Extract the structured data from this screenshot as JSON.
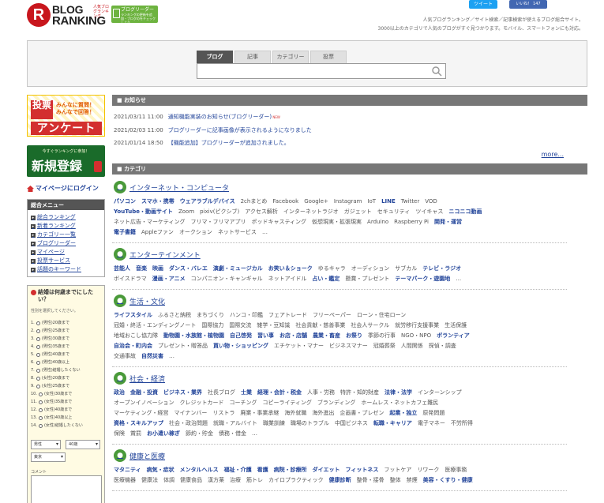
{
  "header": {
    "logo_text_1": "BLOG",
    "logo_text_2": "RANKING",
    "logo_sub": "人気ブログランキング",
    "reader_badge_title": "ブログリーダー",
    "reader_badge_sub": "ランキングの更新を追加・ブログのをチェックしよう",
    "tweet_label": "ツイート",
    "like_label": "いいね！ 147",
    "tagline_1": "人気ブログランキング／サイト検索／記事検索が使えるブログ総合サイト。",
    "tagline_2": "3000以上のカテゴリで人気のブログがすぐ見つかります。モバイル、スマートフォンにも対応。"
  },
  "search": {
    "tabs": [
      "ブログ",
      "記事",
      "カテゴリー",
      "投票"
    ],
    "active_tab": 0,
    "value": ""
  },
  "sidebar": {
    "vote_banner_icon": "投票",
    "vote_banner_text_1": "みんなに質問！",
    "vote_banner_text_2": "みんなで回答！",
    "vote_banner_title": "アンケート",
    "register_sub": "今すぐランキングに参加！",
    "register_title": "新規登録",
    "mypage_login": "マイページにログイン",
    "menu_title": "総合メニュー",
    "menu_items": [
      "総合ランキング",
      "新着ランキング",
      "カテゴリー一覧",
      "ブログリーダー",
      "マイページ",
      "投票サービス",
      "話題のキーワード"
    ],
    "survey_question": "結婚は何歳までにしたい？",
    "survey_note": "性別を選択してください。",
    "survey_options": [
      "1. (男性)20歳まで",
      "2. (男性)25歳まで",
      "3. (男性)30歳まで",
      "4. (男性)35歳まで",
      "5. (男性)40歳まで",
      "6. (男性)40歳以上",
      "7. (男性)結婚したくない",
      "8. (女性)20歳まで",
      "9. (女性)25歳まで",
      "10. (女性)30歳まで",
      "11. (女性)35歳まで",
      "12. (女性)40歳まで",
      "13. (女性)40歳以上",
      "14. (女性)結婚したくない"
    ],
    "survey_select_1": "男性",
    "survey_select_2": "40歳",
    "survey_select_3": "東京",
    "survey_comment_label": "コメント"
  },
  "news": {
    "title": "お知らせ",
    "items": [
      {
        "date": "2021/03/11 11:00",
        "text": "通知機能実装のお知らせ(ブログリーダー)",
        "mark": "NEW"
      },
      {
        "date": "2021/02/03 11:00",
        "text": "ブログリーダーに記事画像が表示されるようになりました",
        "mark": ""
      },
      {
        "date": "2021/01/14 18:50",
        "text": "【機能追加】ブログリーダーが追加されました。",
        "mark": ""
      }
    ],
    "more": "more..."
  },
  "categories": {
    "title": "カテゴリ",
    "blocks": [
      {
        "name": "インターネット・コンピュータ",
        "lines": [
          "パソコン　スマホ・携帯　ウェアラブルデバイス　2chまとめ　Facebook　Google+　Instagram　IoT　LINE　Twitter　VOD",
          "YouTube・動画サイト　Zoom　pixiv(ピクシブ)　アクセス解析　インターネットラジオ　ガジェット　セキュリティ　ツイキャス　ニコニコ動画",
          "ネット広告・マーケティング　フリマ・フリマアプリ　ポッドキャスティング　仮想現実・拡張現実　Arduino　Raspberry Pi　開発・運営",
          "電子書籍　Appleファン　オークション　ネットサービス　…"
        ]
      },
      {
        "name": "エンターテインメント",
        "lines": [
          "芸能人　音楽　映画　ダンス・バレエ　演劇・ミュージカル　お笑い＆ショーク　ゆるキャラ　オーディション　サブカル　テレビ・ラジオ",
          "ボイスドラマ　漫画・アニメ　コンパニオン・キャンギャル　ネットアイドル　占い・鑑定　懸賞・プレゼント　テーマパーク・遊園地　…"
        ]
      },
      {
        "name": "生活・文化",
        "lines": [
          "ライフスタイル　ふるさと納税　まちづくり　ハンコ・印鑑　フェアトレード　フリーペーパー　ローン・住宅ローン",
          "冠婚・終活・エンディングノート　国際協力　国際交流　雑学・豆知識　社会貢献・慈善事業　社会人サークル　就労移行支援事業　生活保護",
          "地域おこし協力隊　動物園・水族館・植物園　自己啓発　習い事　お店・店舗　農業・畜産　お祭り　季節の行事　NGO・NPO　ボランティア",
          "自治会・町内会　プレゼント・贈答品　買い物・ショッピング　エチケット・マナー　ビジネスマナー　冠婚葬祭　人間関係　探偵・調査",
          "交通事故　自然災害　…"
        ]
      },
      {
        "name": "社会・経済",
        "lines": [
          "政治　金融・投資　ビジネス・業界　社長ブログ　士業　経理・会計・税金　人事・労務　特許・知的財産　法律・法学　インターンシップ",
          "オープンイノベーション　クレジットカード　コーチング　コピーライティング　ブランディング　ホームレス・ネットカフェ難民",
          "マーケティング・経営　マイナンバー　リストラ　廃業・事業承継　海外就職　海外進出　企画書・プレゼン　起業・独立　原発問題",
          "資格・スキルアップ　社会・政治問題　就職・アルバイト　職業訓練　職場のトラブル　中国ビジネス　転職・キャリア　電子マネー　不労所得",
          "保険　賞罰　お小遣い稼ぎ　節約・貯金　債務・借金　…"
        ]
      },
      {
        "name": "健康と医療",
        "lines": [
          "マタニティ　病気・症状　メンタルヘルス　福祉・介護　看護　病院・診療所　ダイエット　フィットネス　フットケア　リワーク　医療事務",
          "医療機器　健康法　体調　健康食品　漢方薬　治療　筋トレ　カイロプラクティック　健康診断　整骨・接骨　整体　禁煙　美容・くすり・健康"
        ]
      }
    ]
  },
  "colors": {
    "brand_red": "#c8161d",
    "link_blue": "#23459a",
    "header_gray": "#777777",
    "register_green": "#1a6b2a"
  }
}
